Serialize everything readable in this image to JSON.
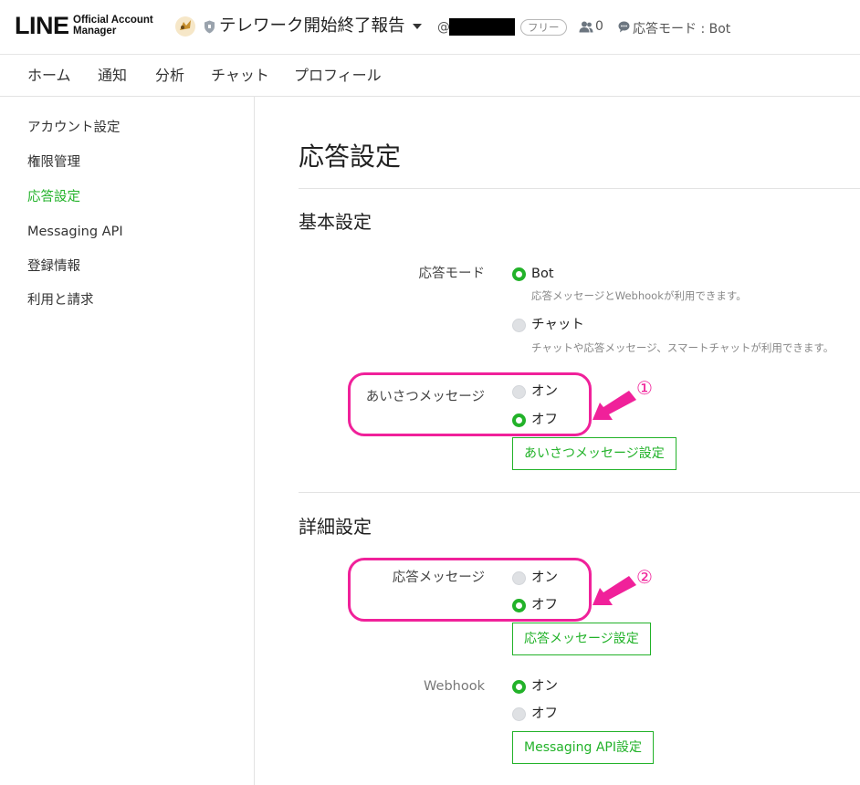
{
  "header": {
    "logo_main": "LINE",
    "logo_sub_1": "Official Account",
    "logo_sub_2": "Manager",
    "account_name": "テレワーク開始終了報告",
    "account_id_prefix": "@",
    "plan_badge": "フリー",
    "friends_count": "0",
    "response_mode_status": "応答モード : Bot"
  },
  "nav": {
    "items": [
      "ホーム",
      "通知",
      "分析",
      "チャット",
      "プロフィール"
    ]
  },
  "sidebar": {
    "items": [
      "アカウント設定",
      "権限管理",
      "応答設定",
      "Messaging API",
      "登録情報",
      "利用と請求"
    ],
    "active_index": 2
  },
  "main": {
    "page_title": "応答設定",
    "basic": {
      "title": "基本設定",
      "response_mode": {
        "label": "応答モード",
        "bot_label": "Bot",
        "bot_desc": "応答メッセージとWebhookが利用できます。",
        "chat_label": "チャット",
        "chat_desc": "チャットや応答メッセージ、スマートチャットが利用できます。",
        "selected": "Bot"
      },
      "greeting": {
        "label": "あいさつメッセージ",
        "on_label": "オン",
        "off_label": "オフ",
        "selected": "オフ",
        "button": "あいさつメッセージ設定"
      }
    },
    "advanced": {
      "title": "詳細設定",
      "auto_reply": {
        "label": "応答メッセージ",
        "on_label": "オン",
        "off_label": "オフ",
        "selected": "オフ",
        "button": "応答メッセージ設定"
      },
      "webhook": {
        "label": "Webhook",
        "on_label": "オン",
        "off_label": "オフ",
        "selected": "オン",
        "button": "Messaging API設定"
      }
    }
  },
  "annotations": {
    "callout_1": "①",
    "callout_2": "②",
    "highlight_color": "#f0219a"
  },
  "colors": {
    "accent": "#22b229",
    "border": "#e3e3e3"
  }
}
